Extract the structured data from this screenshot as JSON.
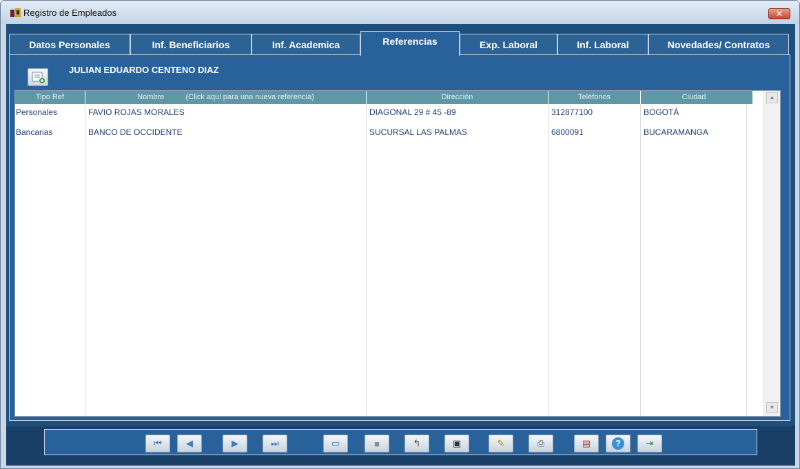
{
  "window": {
    "title": "Registro de Empleados",
    "close_glyph": "✕"
  },
  "tabs": [
    {
      "label": "Datos Personales"
    },
    {
      "label": "Inf. Beneficiarios"
    },
    {
      "label": "Inf. Academica"
    },
    {
      "label": "Referencias",
      "active": true
    },
    {
      "label": "Exp. Laboral"
    },
    {
      "label": "Inf. Laboral"
    },
    {
      "label": "Novedades/ Contratos"
    }
  ],
  "employee": {
    "name": "JULIAN EDUARDO CENTENO DIAZ"
  },
  "grid": {
    "columns": {
      "tipo_ref": "Tipo Ref",
      "nombre": "Nombre",
      "nombre_hint": "(Click aqui para una nueva referencia)",
      "direccion": "Dirección",
      "telefonos": "Teléfonos",
      "ciudad": "Ciudad"
    },
    "rows": [
      {
        "tipo": "Personales",
        "nombre": "FAVIO ROJAS MORALES",
        "direccion": "DIAGONAL 29 # 45 -89",
        "telefono": "312877100",
        "ciudad": "BOGOTÁ"
      },
      {
        "tipo": "Bancarias",
        "nombre": "BANCO DE OCCIDENTE",
        "direccion": "SUCURSAL LAS PALMAS",
        "telefono": "6800091",
        "ciudad": "BUCARAMANGA"
      }
    ],
    "scroll_up": "▲",
    "scroll_down": "▼"
  },
  "toolbar": {
    "first": "⏮",
    "prev": "◀",
    "next": "▶",
    "last": "⏭",
    "new": "▭",
    "stop": "■",
    "undo": "↰",
    "camera": "▣",
    "edit": "✎",
    "print": "⎙",
    "document": "▤",
    "help": "?",
    "exit": "⇥"
  },
  "colors": {
    "client_bg": "#1e4e7c",
    "panel_bg": "#29629a",
    "header_bg": "#5f98a5",
    "grid_text": "#1f3f75"
  }
}
